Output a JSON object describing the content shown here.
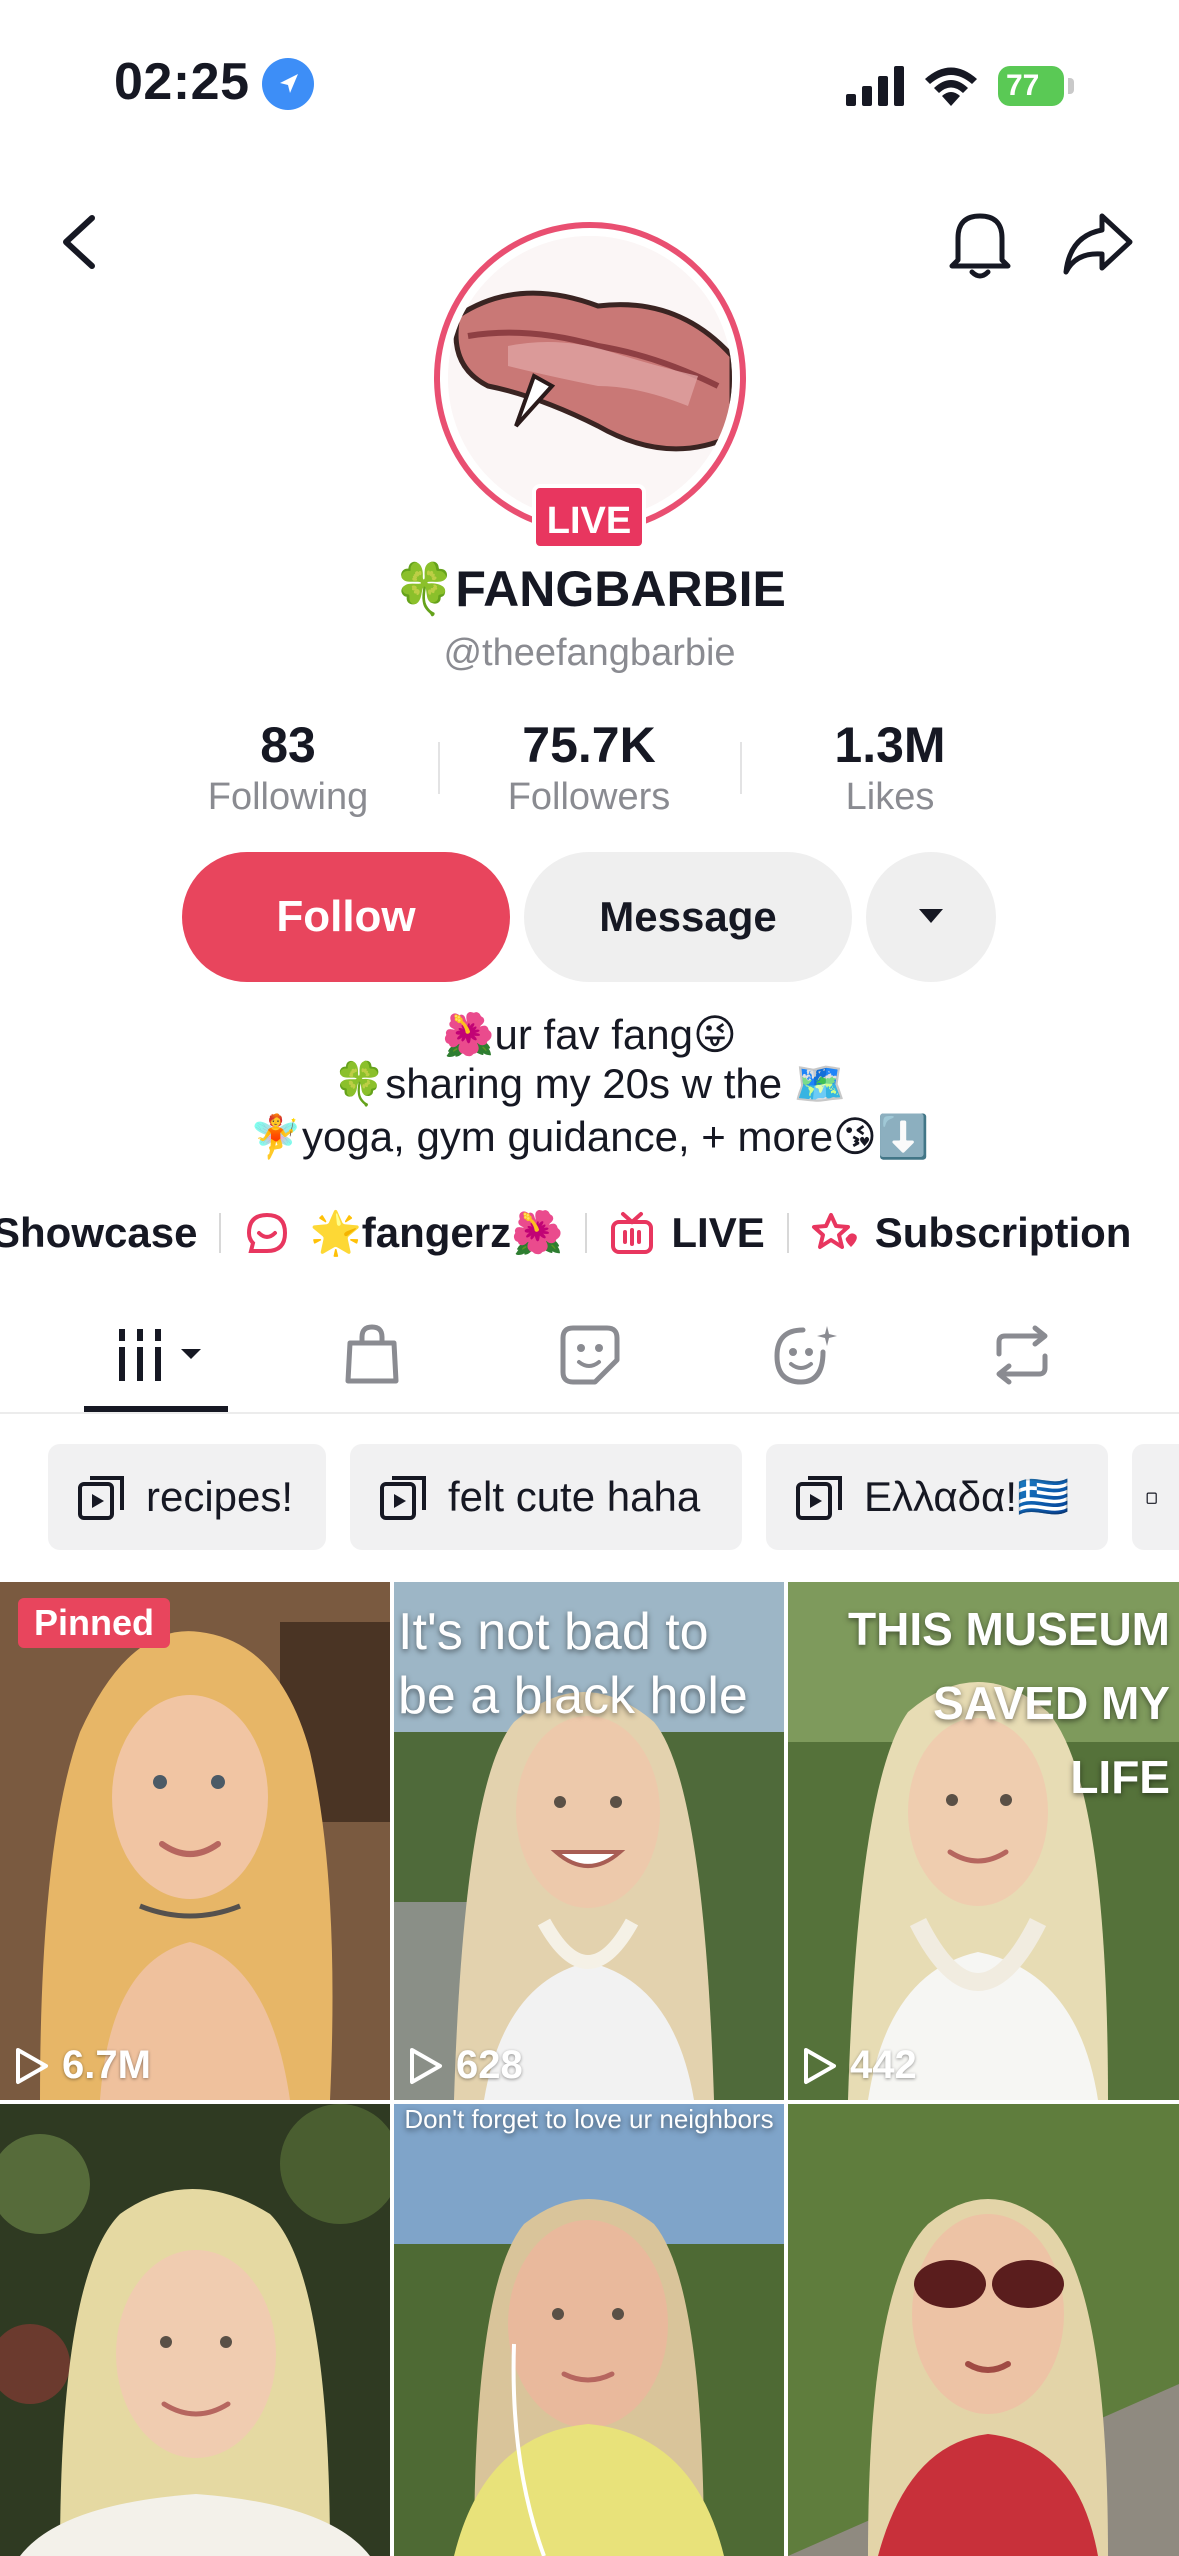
{
  "status_bar": {
    "time": "02:25",
    "battery": "77"
  },
  "profile": {
    "display_name": "🍀FANGBARBIE",
    "handle": "@theefangbarbie",
    "live_badge": "LIVE",
    "stats": [
      {
        "value": "83",
        "label": "Following"
      },
      {
        "value": "75.7K",
        "label": "Followers"
      },
      {
        "value": "1.3M",
        "label": "Likes"
      }
    ],
    "follow_label": "Follow",
    "message_label": "Message",
    "bio": [
      "🌺ur fav fang😜",
      "🍀sharing my 20s w the 🗺️",
      "🧚yoga, gym guidance, + more😘⬇️"
    ]
  },
  "links": [
    {
      "label": "Showcase",
      "icon": ""
    },
    {
      "label": "🌟fangerz🌺",
      "icon": "chat-bubble-icon"
    },
    {
      "label": "LIVE",
      "icon": "tv-icon"
    },
    {
      "label": "Subscription",
      "icon": "star-heart-icon"
    }
  ],
  "tabs": [
    "videos-grid-icon",
    "shop-bag-icon",
    "sticker-icon",
    "favorites-face-icon",
    "repost-icon"
  ],
  "playlists": [
    "recipes!",
    "felt cute haha",
    "Ελλαδα!🇬🇷"
  ],
  "videos": [
    {
      "pinned": "Pinned",
      "views": "6.7M",
      "caption": ""
    },
    {
      "pinned": "",
      "views": "628",
      "caption": "It's not bad to be a black hole"
    },
    {
      "pinned": "",
      "views": "442",
      "caption": "THIS MUSEUM SAVED MY LIFE"
    },
    {
      "pinned": "",
      "views": "",
      "caption": ""
    },
    {
      "pinned": "",
      "views": "",
      "caption": "Don't forget to love ur neighbors"
    },
    {
      "pinned": "",
      "views": "",
      "caption": ""
    }
  ],
  "colors": {
    "accent": "#e8455d",
    "live": "#e8365f",
    "link_icon": "#e8365f"
  }
}
